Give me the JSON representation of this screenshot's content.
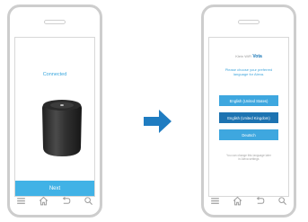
{
  "left_phone": {
    "status_text": "Connected",
    "next_button_label": "Next"
  },
  "right_phone": {
    "brand_prefix": "Klein WiFi",
    "brand_name": "Vota",
    "prompt": "Please choose your preferred language for Alexa.",
    "languages": [
      "English (United States)",
      "English (United Kingdom)",
      "Deutsch"
    ],
    "note": "You can change this language later in Alexa settings"
  },
  "icons": [
    "menu-icon",
    "home-icon",
    "back-icon",
    "search-icon",
    "right-arrow-icon",
    "smart-speaker-icon"
  ],
  "colors": {
    "accent": "#41b2e6",
    "accent_dark": "#1d73b1",
    "phone_frame": "#cdcdcd",
    "arrow": "#1f7cc1"
  }
}
